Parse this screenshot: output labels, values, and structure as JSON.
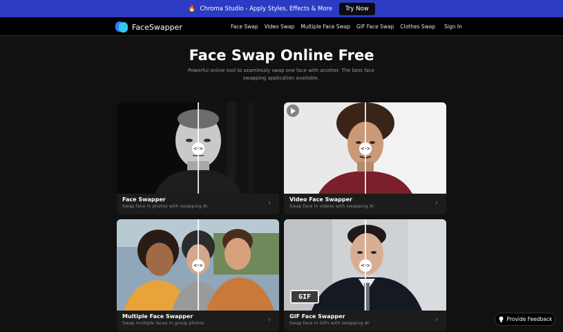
{
  "banner": {
    "text": "Chroma Studio - Apply Styles, Effects & More",
    "button": "Try Now",
    "fire": "🔥"
  },
  "nav": {
    "logo": "FaceSwapper",
    "links": [
      "Face Swap",
      "Video Swap",
      "Multiple Face Swap",
      "GIF Face Swap",
      "Clothes Swap"
    ],
    "signin": "Sign In"
  },
  "hero": {
    "title": "Face Swap Online Free",
    "subtitle": "Powerful online tool to seamlessly swap one face with another. The best face swapping application available."
  },
  "cards": [
    {
      "title": "Face Swapper",
      "desc": "Swap face in photos with swapping AI"
    },
    {
      "title": "Video Face Swapper",
      "desc": "Swap face in videos with swapping AI"
    },
    {
      "title": "Multiple Face Swapper",
      "desc": "Swap multiple faces in group photos"
    },
    {
      "title": "GIF Face Swapper",
      "desc": "Swap face in GIFs with swapping AI",
      "badge": "GIF"
    }
  ],
  "handle_glyph": "<·>",
  "chevron": "›",
  "feedback": "Provide Feedback",
  "colors": {
    "banner": "#2b3cc2",
    "background": "#111111",
    "logo_dark": "#2e7cf6",
    "logo_light": "#37c7f3"
  }
}
